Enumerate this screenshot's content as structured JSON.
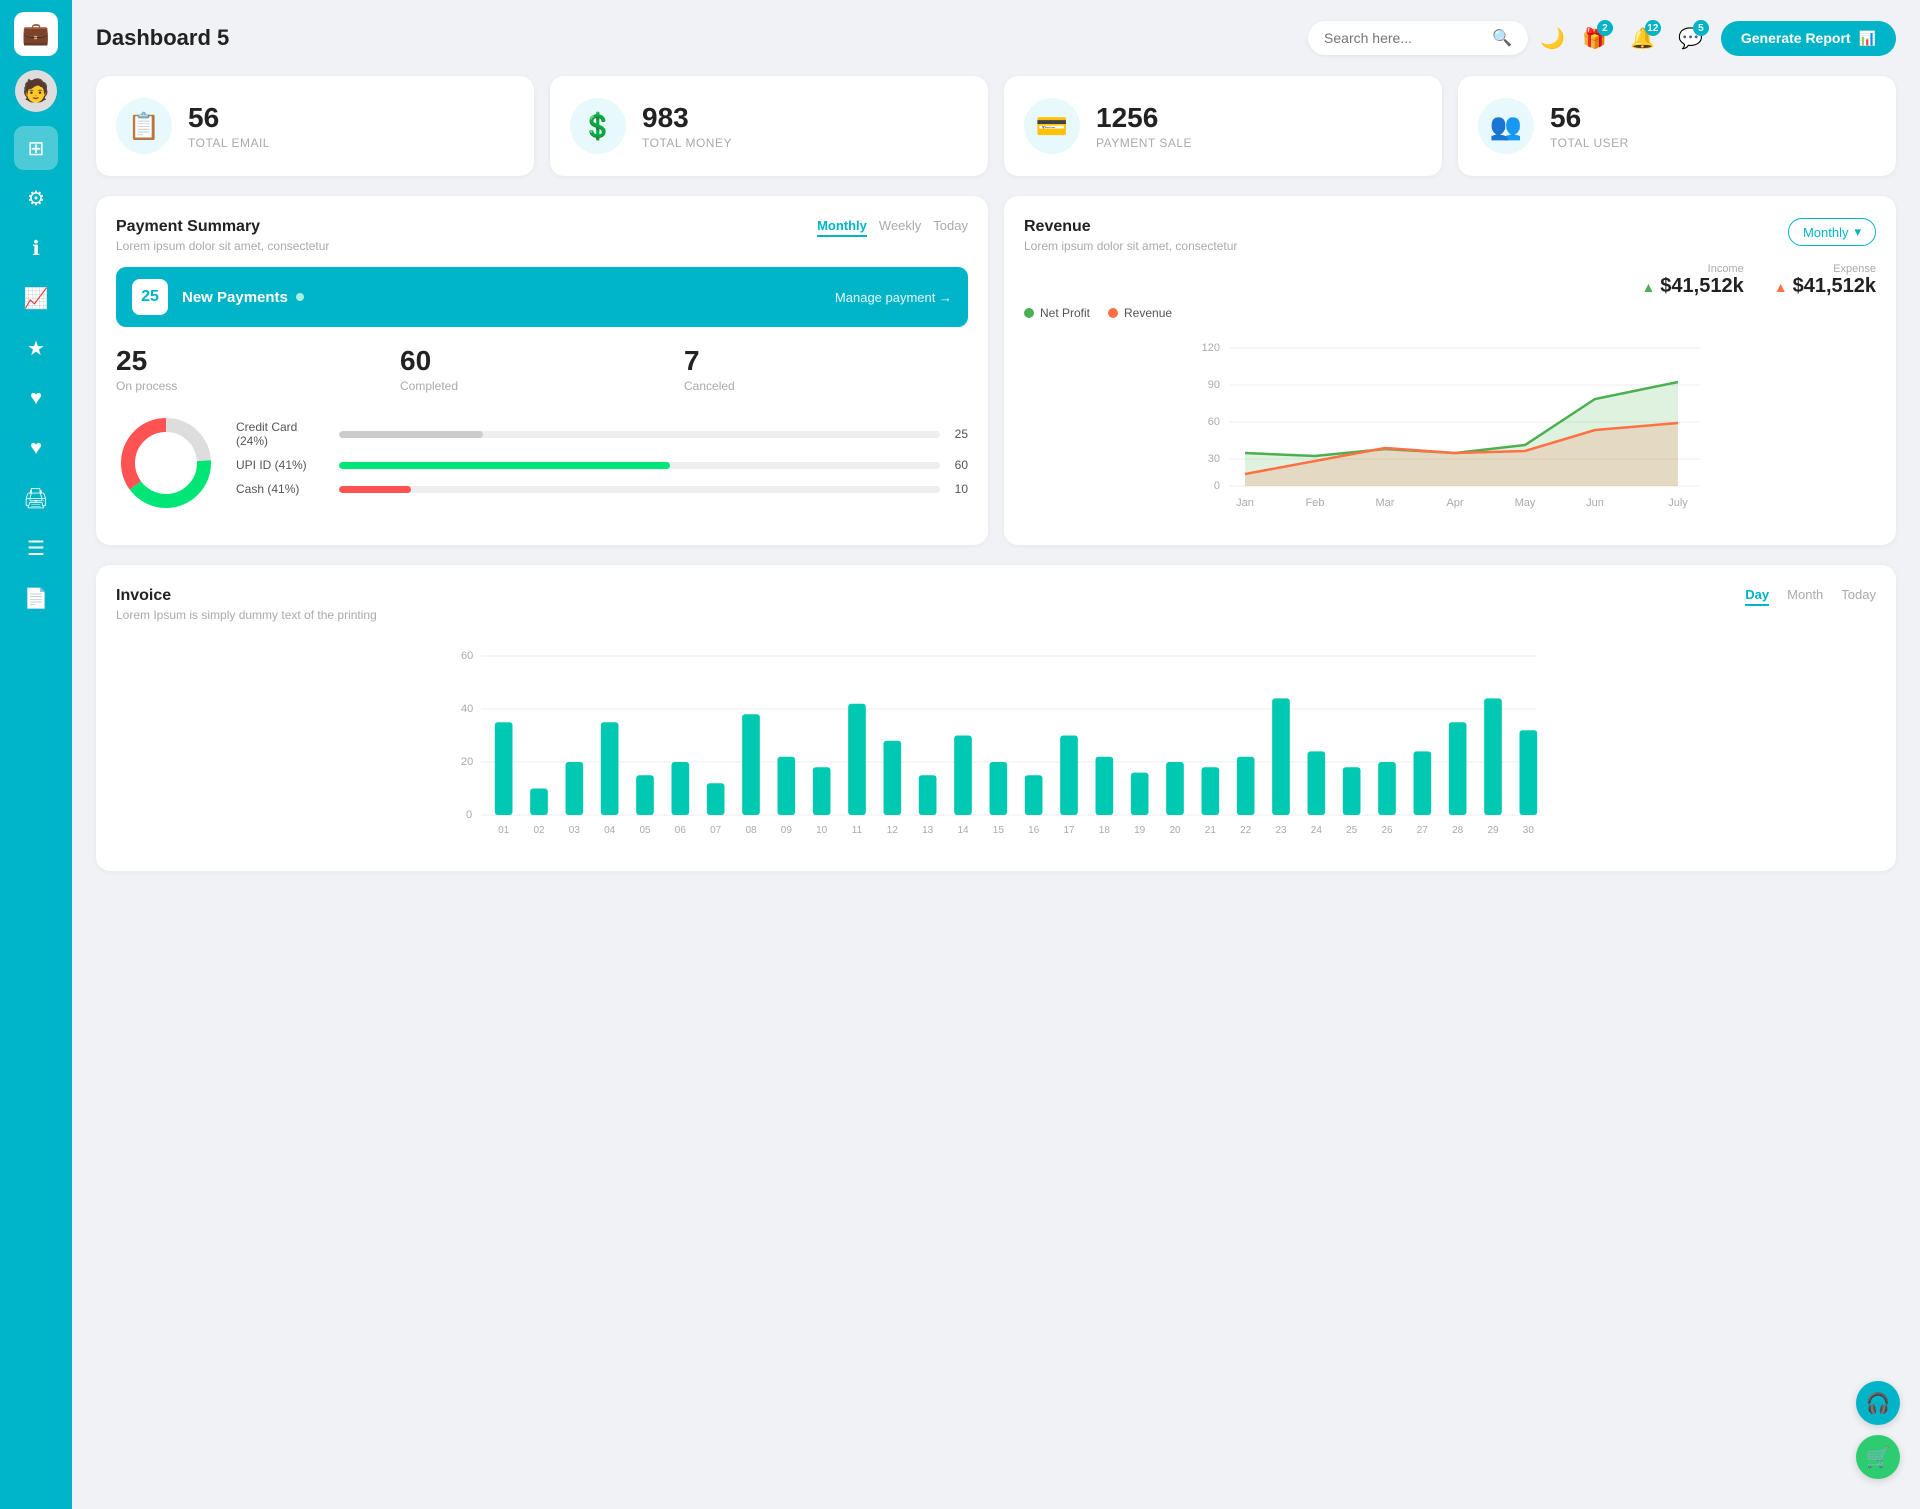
{
  "app": {
    "title": "Dashboard 5"
  },
  "header": {
    "search_placeholder": "Search here...",
    "generate_btn": "Generate Report",
    "badges": {
      "gift": "2",
      "bell": "12",
      "chat": "5"
    }
  },
  "stats": [
    {
      "id": "email",
      "num": "56",
      "label": "TOTAL EMAIL",
      "icon": "📋"
    },
    {
      "id": "money",
      "num": "983",
      "label": "TOTAL MONEY",
      "icon": "💲"
    },
    {
      "id": "payment",
      "num": "1256",
      "label": "PAYMENT SALE",
      "icon": "💳"
    },
    {
      "id": "user",
      "num": "56",
      "label": "TOTAL USER",
      "icon": "👥"
    }
  ],
  "payment_summary": {
    "title": "Payment Summary",
    "subtitle": "Lorem ipsum dolor sit amet, consectetur",
    "tabs": [
      "Monthly",
      "Weekly",
      "Today"
    ],
    "active_tab": "Monthly",
    "new_payments_count": "25",
    "new_payments_label": "New Payments",
    "manage_link": "Manage payment →",
    "metrics": [
      {
        "num": "25",
        "label": "On process"
      },
      {
        "num": "60",
        "label": "Completed"
      },
      {
        "num": "7",
        "label": "Canceled"
      }
    ],
    "donut": {
      "segments": [
        {
          "label": "Credit Card (24%)",
          "pct": 24,
          "color": "#ccc",
          "value": "25"
        },
        {
          "label": "UPI ID (41%)",
          "pct": 41,
          "color": "#00e676",
          "value": "60"
        },
        {
          "label": "Cash (41%)",
          "pct": 35,
          "color": "#ff5252",
          "value": "10"
        }
      ]
    }
  },
  "revenue": {
    "title": "Revenue",
    "subtitle": "Lorem ipsum dolor sit amet, consectetur",
    "monthly_label": "Monthly",
    "income": {
      "label": "Income",
      "value": "$41,512k"
    },
    "expense": {
      "label": "Expense",
      "value": "$41,512k"
    },
    "legend": [
      {
        "label": "Net Profit",
        "color": "#4caf50"
      },
      {
        "label": "Revenue",
        "color": "#ff7043"
      }
    ],
    "x_labels": [
      "Jan",
      "Feb",
      "Mar",
      "Apr",
      "May",
      "Jun",
      "July"
    ],
    "y_labels": [
      "0",
      "30",
      "60",
      "90",
      "120"
    ],
    "chart": {
      "net_profit": [
        28,
        25,
        32,
        28,
        35,
        75,
        90
      ],
      "revenue": [
        10,
        22,
        35,
        28,
        30,
        48,
        55
      ]
    }
  },
  "invoice": {
    "title": "Invoice",
    "subtitle": "Lorem Ipsum is simply dummy text of the printing",
    "tabs": [
      "Day",
      "Month",
      "Today"
    ],
    "active_tab": "Day",
    "y_labels": [
      "0",
      "20",
      "40",
      "60"
    ],
    "x_labels": [
      "01",
      "02",
      "03",
      "04",
      "05",
      "06",
      "07",
      "08",
      "09",
      "10",
      "11",
      "12",
      "13",
      "14",
      "15",
      "16",
      "17",
      "18",
      "19",
      "20",
      "21",
      "22",
      "23",
      "24",
      "25",
      "26",
      "27",
      "28",
      "29",
      "30"
    ],
    "bars": [
      35,
      10,
      20,
      35,
      15,
      20,
      12,
      38,
      22,
      18,
      42,
      28,
      15,
      30,
      20,
      15,
      30,
      22,
      16,
      20,
      18,
      22,
      44,
      24,
      18,
      20,
      24,
      35,
      44,
      32
    ]
  },
  "sidebar": {
    "items": [
      {
        "id": "wallet",
        "icon": "💼",
        "active": false
      },
      {
        "id": "dashboard",
        "icon": "⊞",
        "active": true
      },
      {
        "id": "settings",
        "icon": "⚙",
        "active": false
      },
      {
        "id": "info",
        "icon": "ℹ",
        "active": false
      },
      {
        "id": "chart",
        "icon": "📈",
        "active": false
      },
      {
        "id": "star",
        "icon": "★",
        "active": false
      },
      {
        "id": "heart1",
        "icon": "♥",
        "active": false
      },
      {
        "id": "heart2",
        "icon": "♥",
        "active": false
      },
      {
        "id": "print",
        "icon": "🖨",
        "active": false
      },
      {
        "id": "menu",
        "icon": "☰",
        "active": false
      },
      {
        "id": "list",
        "icon": "📄",
        "active": false
      }
    ]
  },
  "float_btns": [
    {
      "id": "headset",
      "icon": "🎧",
      "color": "teal"
    },
    {
      "id": "cart",
      "icon": "🛒",
      "color": "green"
    }
  ]
}
